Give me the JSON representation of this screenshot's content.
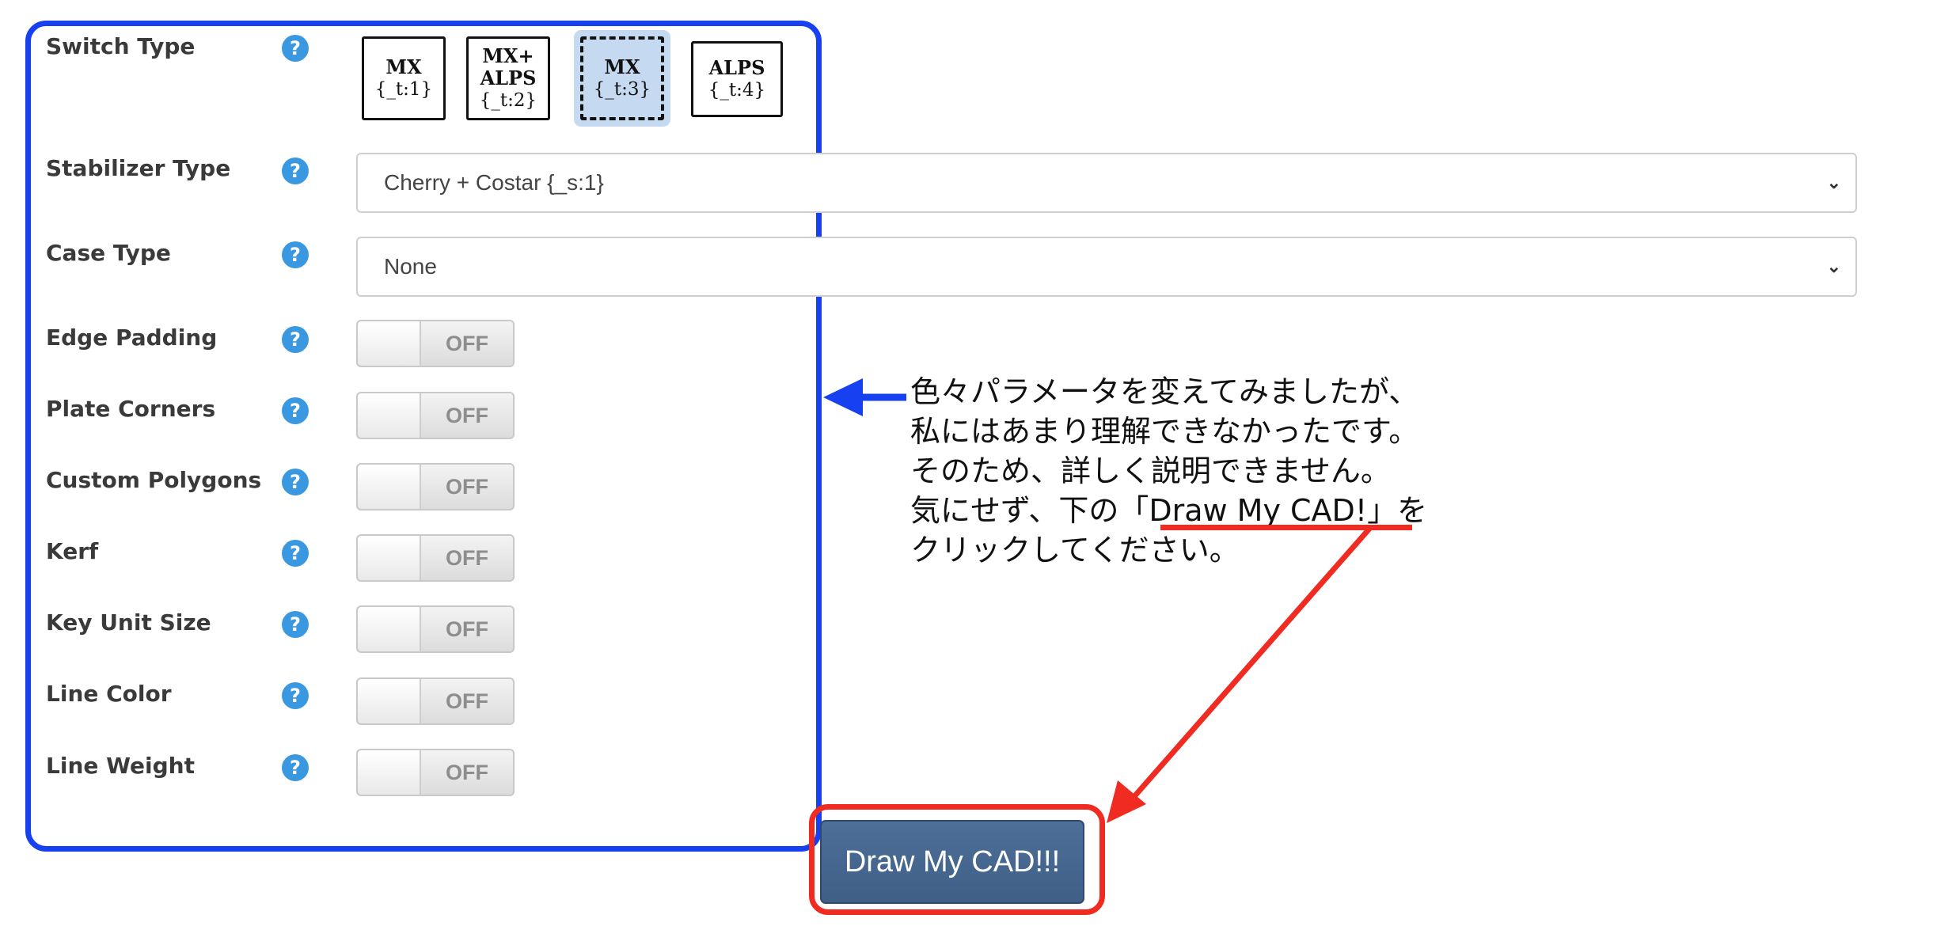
{
  "switch_type": {
    "label": "Switch Type",
    "options": [
      {
        "line1": "MX",
        "line2": "",
        "line3": "{_t:1}"
      },
      {
        "line1": "MX+",
        "line2": "ALPS",
        "line3": "{_t:2}"
      },
      {
        "line1": "MX",
        "line2": "",
        "line3": "{_t:3}"
      },
      {
        "line1": "ALPS",
        "line2": "",
        "line3": "{_t:4}"
      }
    ],
    "selected": "MX {_t:3}"
  },
  "stabilizer_type": {
    "label": "Stabilizer Type",
    "value": "Cherry + Costar {_s:1}"
  },
  "case_type": {
    "label": "Case Type",
    "value": "None"
  },
  "toggles": [
    {
      "label": "Edge Padding",
      "state": "OFF"
    },
    {
      "label": "Plate Corners",
      "state": "OFF"
    },
    {
      "label": "Custom Polygons",
      "state": "OFF"
    },
    {
      "label": "Kerf",
      "state": "OFF"
    },
    {
      "label": "Key Unit Size",
      "state": "OFF"
    },
    {
      "label": "Line Color",
      "state": "OFF"
    },
    {
      "label": "Line Weight",
      "state": "OFF"
    }
  ],
  "help_glyph": "?",
  "draw_button": {
    "label": "Draw My CAD!!!"
  },
  "annotation": {
    "line1": "色々パラメータを変えてみましたが、",
    "line2": "私にはあまり理解できなかったです。",
    "line3": "そのため、詳しく説明できません。",
    "line4_prefix": "気にせず、下の「",
    "line4_highlight": "Draw My CAD!",
    "line4_suffix": "」を",
    "line5": "クリックしてください。"
  },
  "colors": {
    "panel_outline": "#1640f0",
    "highlight": "#ef2b22",
    "button": "#44658e",
    "help_icon": "#3a98e0",
    "selected_option": "#c5d9f1"
  }
}
